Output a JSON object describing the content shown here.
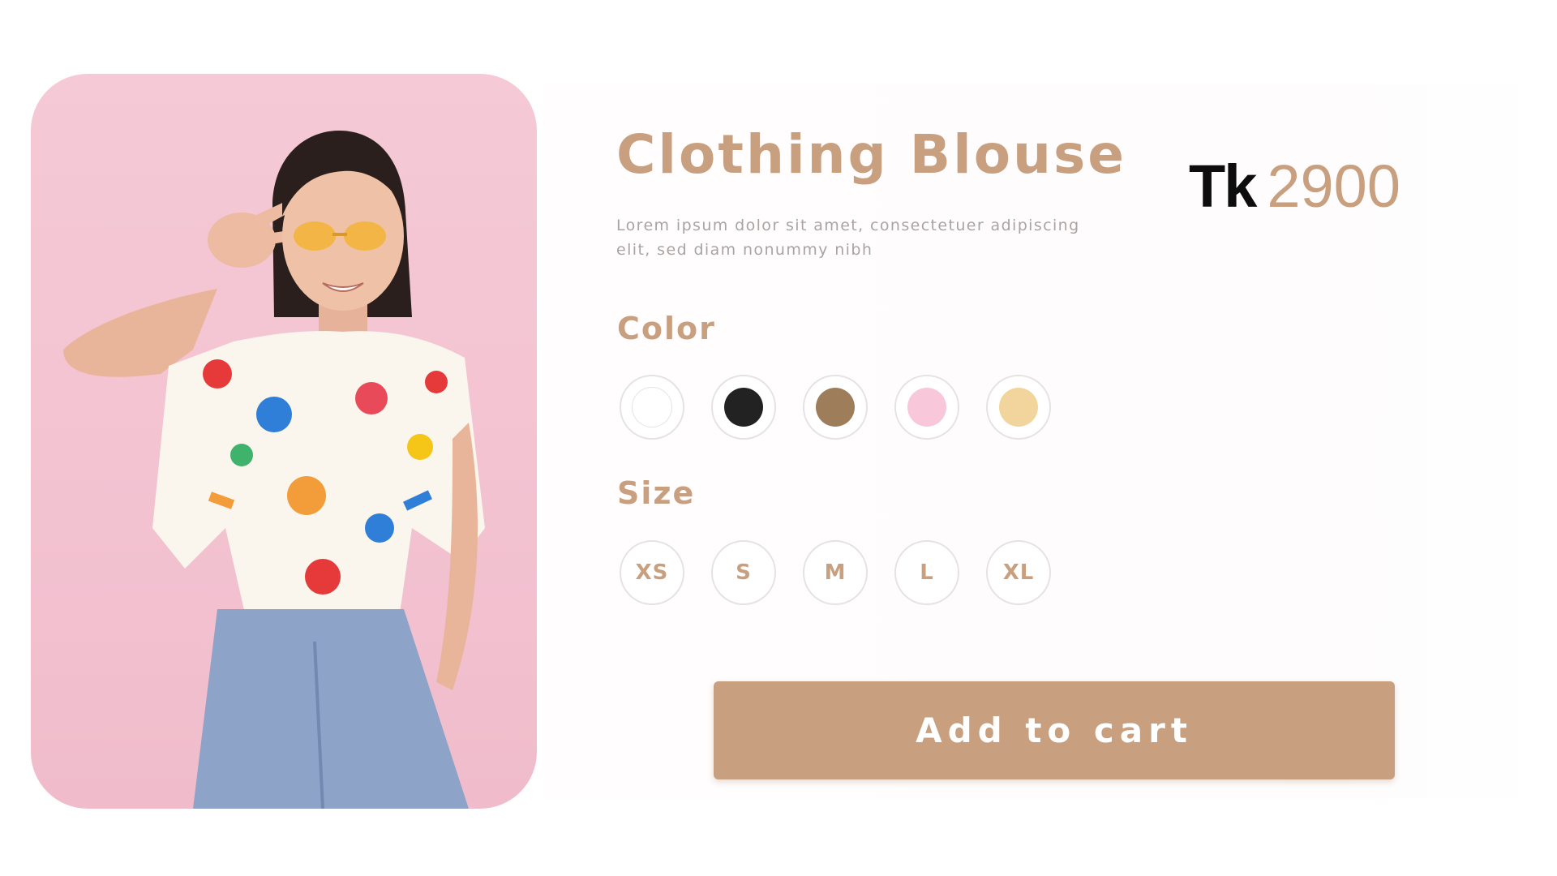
{
  "product": {
    "title": "Clothing Blouse",
    "description": "Lorem ipsum dolor sit amet, consectetuer adipiscing elit, sed diam nonummy nibh",
    "price_currency": "Tk",
    "price_amount": "2900"
  },
  "color_section": {
    "label": "Color",
    "swatches": [
      {
        "name": "white",
        "hex": "#ffffff"
      },
      {
        "name": "black",
        "hex": "#222222"
      },
      {
        "name": "brown",
        "hex": "#9e7d5a"
      },
      {
        "name": "pink",
        "hex": "#f8c7da"
      },
      {
        "name": "cream",
        "hex": "#f2d59c"
      }
    ]
  },
  "size_section": {
    "label": "Size",
    "sizes": [
      "XS",
      "S",
      "M",
      "L",
      "XL"
    ]
  },
  "cart_button": {
    "label": "Add to cart"
  },
  "colors": {
    "accent": "#c8a07f",
    "card_background": "#f4c6d4",
    "description_text": "#a9a4a4"
  }
}
